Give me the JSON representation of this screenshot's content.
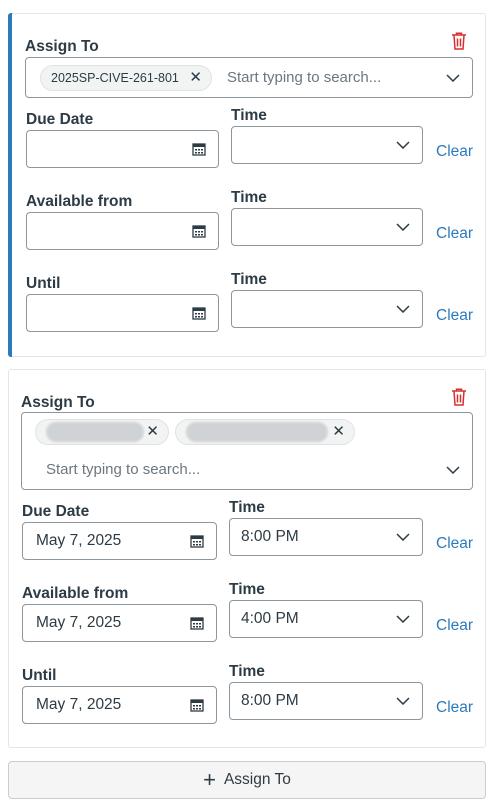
{
  "colors": {
    "accent": "#2b7abc",
    "danger": "#d5302f",
    "text": "#2d3b45",
    "border": "#8b969e"
  },
  "cards": [
    {
      "assign_label": "Assign To",
      "chips": [
        {
          "label": "2025SP-CIVE-261-801"
        }
      ],
      "search_placeholder": "Start typing to search...",
      "due_label": "Due Date",
      "due_date": "",
      "due_time_label": "Time",
      "due_time": "",
      "available_label": "Available from",
      "available_date": "",
      "available_time_label": "Time",
      "available_time": "",
      "until_label": "Until",
      "until_date": "",
      "until_time_label": "Time",
      "until_time": "",
      "clear_label": "Clear"
    },
    {
      "assign_label": "Assign To",
      "chips": [
        {
          "label": ""
        },
        {
          "label": ""
        }
      ],
      "search_placeholder": "Start typing to search...",
      "due_label": "Due Date",
      "due_date": "May 7, 2025",
      "due_time_label": "Time",
      "due_time": "8:00 PM",
      "available_label": "Available from",
      "available_date": "May 7, 2025",
      "available_time_label": "Time",
      "available_time": "4:00 PM",
      "until_label": "Until",
      "until_date": "May 7, 2025",
      "until_time_label": "Time",
      "until_time": "8:00 PM",
      "clear_label": "Clear"
    }
  ],
  "add_button_label": "Assign To",
  "icons": {
    "delete": "trash-icon",
    "calendar": "calendar-icon",
    "dropdown": "chevron-down-icon",
    "remove": "close-icon",
    "add": "plus-icon"
  }
}
